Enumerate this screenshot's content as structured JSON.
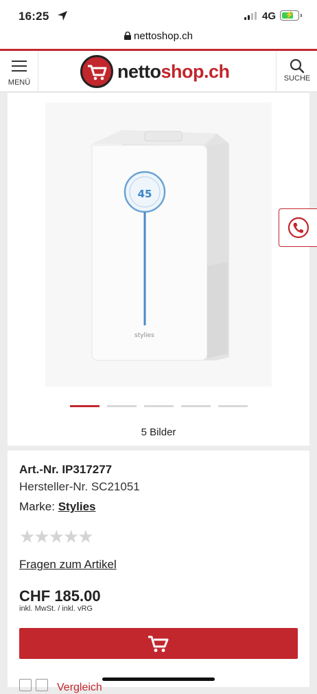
{
  "status_bar": {
    "time": "16:25",
    "network": "4G",
    "location_icon": "location-arrow-icon"
  },
  "browser": {
    "url": "nettoshop.ch"
  },
  "header": {
    "menu_label": "MENÜ",
    "logo_part1": "netto",
    "logo_part2": "shop.ch",
    "search_label": "SUCHE"
  },
  "gallery": {
    "image_count_label": "5 Bilder",
    "product_brand_text": "stylies",
    "display_value": "45",
    "slides": 5,
    "active_slide": 1
  },
  "product": {
    "art_nr": "Art.-Nr. IP317277",
    "hersteller_nr": "Hersteller-Nr. SC21051",
    "marke_prefix": "Marke: ",
    "marke_value": "Stylies",
    "rating_stars": 0,
    "rating_max": 5,
    "questions_link": "Fragen zum Artikel",
    "price": "CHF 185.00",
    "price_note": "inkl. MwSt. / inkl. vRG",
    "bottom_label": "Vergleich"
  },
  "colors": {
    "brand_red": "#c1272d",
    "battery_green": "#3ccf4e"
  }
}
